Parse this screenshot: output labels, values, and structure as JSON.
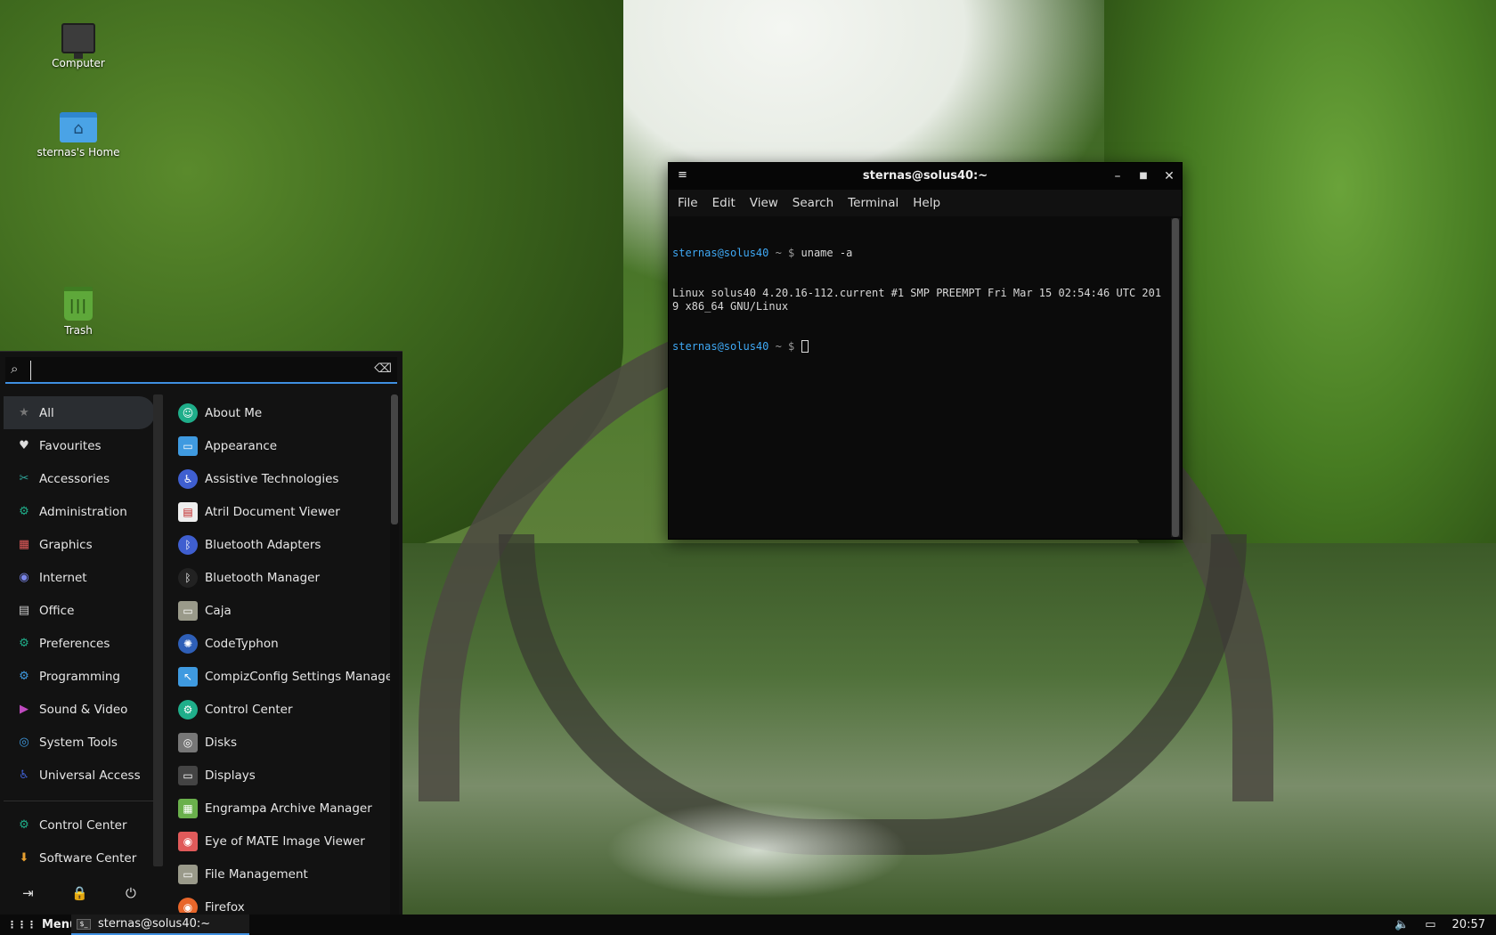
{
  "desktop": {
    "icons": [
      {
        "label": "Computer",
        "icon": "computer-icon"
      },
      {
        "label": "sternas's Home",
        "icon": "home-folder-icon"
      },
      {
        "label": "Trash",
        "icon": "trash-icon"
      }
    ]
  },
  "terminal": {
    "title": "sternas@solus40:~",
    "menu": [
      "File",
      "Edit",
      "View",
      "Search",
      "Terminal",
      "Help"
    ],
    "lines": [
      {
        "user": "sternas@solus40",
        "path": " ~ $ ",
        "cmd": "uname -a"
      },
      {
        "output": "Linux solus40 4.20.16-112.current #1 SMP PREEMPT Fri Mar 15 02:54:46 UTC 2019 x86_64 GNU/Linux"
      },
      {
        "user": "sternas@solus40",
        "path": " ~ $ ",
        "cmd": ""
      }
    ]
  },
  "app_menu": {
    "search_value": "",
    "categories": [
      {
        "label": "All",
        "icon": "star-icon",
        "color": "#777777",
        "active": true
      },
      {
        "label": "Favourites",
        "icon": "heart-icon",
        "color": "#dddddd"
      },
      {
        "label": "Accessories",
        "icon": "accessories-icon",
        "color": "#2fa69a"
      },
      {
        "label": "Administration",
        "icon": "administration-icon",
        "color": "#1fae8a"
      },
      {
        "label": "Graphics",
        "icon": "graphics-icon",
        "color": "#e05a5a"
      },
      {
        "label": "Internet",
        "icon": "internet-icon",
        "color": "#7a86e8"
      },
      {
        "label": "Office",
        "icon": "office-icon",
        "color": "#cccccc"
      },
      {
        "label": "Preferences",
        "icon": "preferences-icon",
        "color": "#1fae8a"
      },
      {
        "label": "Programming",
        "icon": "programming-icon",
        "color": "#3f9ae0"
      },
      {
        "label": "Sound & Video",
        "icon": "sound-video-icon",
        "color": "#c04ac0"
      },
      {
        "label": "System Tools",
        "icon": "system-tools-icon",
        "color": "#3f9ae0"
      },
      {
        "label": "Universal Access",
        "icon": "universal-access-icon",
        "color": "#3f5fd0"
      }
    ],
    "pinned": [
      {
        "label": "Control Center",
        "icon": "control-center-icon",
        "color": "#1fae8a"
      },
      {
        "label": "Software Center",
        "icon": "software-center-icon",
        "color": "#e8a030"
      }
    ],
    "apps": [
      {
        "label": "About Me",
        "icon": "about-me-icon",
        "color": "#1fae8a"
      },
      {
        "label": "Appearance",
        "icon": "appearance-icon",
        "color": "#3f9ae0"
      },
      {
        "label": "Assistive Technologies",
        "icon": "assistive-technologies-icon",
        "color": "#3f5fd0"
      },
      {
        "label": "Atril Document Viewer",
        "icon": "atril-icon",
        "color": "#eeeeee"
      },
      {
        "label": "Bluetooth Adapters",
        "icon": "bluetooth-icon",
        "color": "#3f5fd0"
      },
      {
        "label": "Bluetooth Manager",
        "icon": "bluetooth-manager-icon",
        "color": "#222222"
      },
      {
        "label": "Caja",
        "icon": "caja-icon",
        "color": "#9a9a8a"
      },
      {
        "label": "CodeTyphon",
        "icon": "codetyphon-icon",
        "color": "#2e5fb8"
      },
      {
        "label": "CompizConfig Settings Manager",
        "icon": "compizconfig-icon",
        "color": "#3f9ae0"
      },
      {
        "label": "Control Center",
        "icon": "control-center-icon",
        "color": "#1fae8a"
      },
      {
        "label": "Disks",
        "icon": "disks-icon",
        "color": "#777777"
      },
      {
        "label": "Displays",
        "icon": "displays-icon",
        "color": "#444444"
      },
      {
        "label": "Engrampa Archive Manager",
        "icon": "engrampa-icon",
        "color": "#6ab04c"
      },
      {
        "label": "Eye of MATE Image Viewer",
        "icon": "eye-of-mate-icon",
        "color": "#e05a5a"
      },
      {
        "label": "File Management",
        "icon": "file-management-icon",
        "color": "#9a9a8a"
      },
      {
        "label": "Firefox",
        "icon": "firefox-icon",
        "color": "#e8662a"
      }
    ],
    "actions": [
      {
        "name": "logout-icon",
        "glyph": "⇥"
      },
      {
        "name": "lock-icon",
        "glyph": "🔒"
      },
      {
        "name": "power-icon",
        "glyph": "⏻"
      }
    ]
  },
  "panel": {
    "menu_label": "Menu",
    "task_label": "sternas@solus40:~",
    "clock": "20:57"
  }
}
